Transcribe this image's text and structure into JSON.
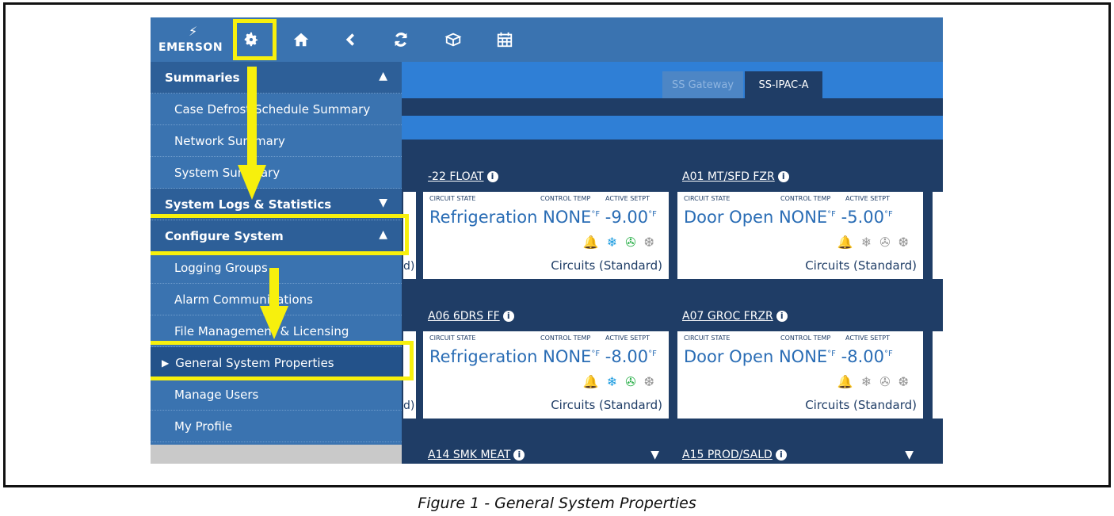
{
  "topbar": {
    "logo_text": "EMERSON",
    "icons": [
      "gear-icon",
      "home-icon",
      "back-icon",
      "refresh-icon",
      "box-icon",
      "calendar-icon"
    ]
  },
  "tabs": {
    "gateway": "SS Gateway",
    "active": "SS-IPAC-A"
  },
  "menu": {
    "summaries": "Summaries",
    "case_defrost": "Case Defrost Schedule Summary",
    "network_summary": "Network Summary",
    "system_summary": "System Summary",
    "system_logs": "System Logs & Statistics",
    "configure_system": "Configure System",
    "logging_groups": "Logging Groups",
    "alarm_communications": "Alarm Communications",
    "file_management": "File Management & Licensing",
    "general_system_properties": "General System Properties",
    "manage_users": "Manage Users",
    "my_profile": "My Profile"
  },
  "labels": {
    "circuit_state": "CIRCUIT STATE",
    "control_temp": "CONTROL TEMP",
    "active_setpt": "ACTIVE SETPT",
    "circuits": "Circuits (Standard)",
    "partial_suffix": "d)"
  },
  "cards": [
    {
      "title": "-22 FLOAT",
      "state": "Refrigeration",
      "temp": "NONE",
      "setpt": "-9.00",
      "unit": "°F"
    },
    {
      "title": "A01 MT/SFD FZR",
      "state": "Door Open",
      "temp": "NONE",
      "setpt": "-5.00",
      "unit": "°F"
    },
    {
      "title": "A06 6DRS FF",
      "state": "Refrigeration",
      "temp": "NONE",
      "setpt": "-8.00",
      "unit": "°F"
    },
    {
      "title": "A07 GROC FRZR",
      "state": "Door Open",
      "temp": "NONE",
      "setpt": "-8.00",
      "unit": "°F"
    }
  ],
  "bottom_cards": [
    "A14 SMK MEAT",
    "A15 PROD/SALD"
  ],
  "colors": {
    "highlight": "#f7f00d",
    "menu_bg": "#3a73b0",
    "dark_bg": "#1f3d66",
    "accent": "#2f7fd6"
  },
  "caption": "Figure 1 - General System Properties"
}
